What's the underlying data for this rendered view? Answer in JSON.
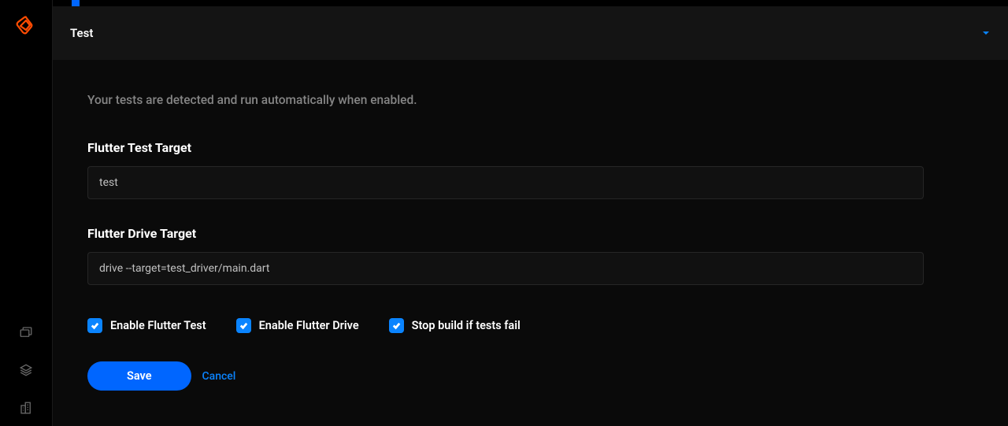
{
  "section": {
    "title": "Test"
  },
  "form": {
    "description": "Your tests are detected and run automatically when enabled.",
    "fields": {
      "flutter_test": {
        "label": "Flutter Test Target",
        "value": "test"
      },
      "flutter_drive": {
        "label": "Flutter Drive Target",
        "value": "drive --target=test_driver/main.dart"
      }
    },
    "checkboxes": {
      "enable_test": {
        "label": "Enable Flutter Test",
        "checked": true
      },
      "enable_drive": {
        "label": "Enable Flutter Drive",
        "checked": true
      },
      "stop_on_fail": {
        "label": "Stop build if tests fail",
        "checked": true
      }
    },
    "buttons": {
      "save": "Save",
      "cancel": "Cancel"
    }
  },
  "sidebar": {
    "icons": [
      "folders",
      "layers",
      "buildings"
    ]
  },
  "colors": {
    "accent": "#0a84ff",
    "primary_button": "#0066ff",
    "bg": "#000000",
    "panel": "#0a0a0a",
    "header": "#141414"
  }
}
